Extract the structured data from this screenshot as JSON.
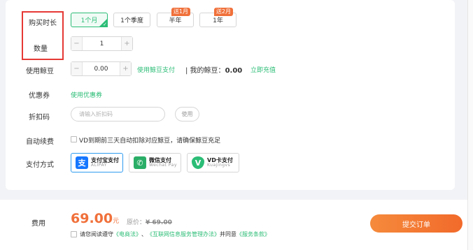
{
  "form": {
    "duration_label": "购买时长",
    "quantity_label": "数量",
    "bean_label": "使用鲸豆",
    "coupon_label": "优惠券",
    "discount_label": "折扣码",
    "autorenew_label": "自动续费",
    "payment_label": "支付方式"
  },
  "durations": [
    {
      "label": "1个月",
      "selected": true,
      "tag": ""
    },
    {
      "label": "1个季度",
      "selected": false,
      "tag": ""
    },
    {
      "label": "半年",
      "selected": false,
      "tag": "送1月"
    },
    {
      "label": "1年",
      "selected": false,
      "tag": "送2月"
    }
  ],
  "quantity": {
    "minus": "−",
    "value": "1",
    "plus": "+"
  },
  "beans": {
    "minus": "−",
    "value": "0.00",
    "plus": "+",
    "pay_link": "使用鲸豆支付",
    "my_beans_prefix": "| 我的鲸豆：",
    "my_beans_value": "0.00",
    "recharge_link": "立即充值"
  },
  "coupon": {
    "link": "使用优惠券"
  },
  "discount": {
    "placeholder": "请输入折扣码",
    "use_button": "使用"
  },
  "autorenew": {
    "text": "VD到期前三天自动扣除对应鲸豆，请确保鲸豆充足",
    "checked": false
  },
  "payments": [
    {
      "name": "支付宝支付",
      "sub": "ALIPAY",
      "icon": "alipay-icon",
      "glyph": "支",
      "color": "#1677ff",
      "selected": true
    },
    {
      "name": "微信支付",
      "sub": "Wechat Pay",
      "icon": "wechat-icon",
      "glyph": "✆",
      "color": "#2aae67",
      "selected": false
    },
    {
      "name": "VD卡支付",
      "sub": "Kuajingvs",
      "icon": "vd-card-icon",
      "glyph": "V",
      "color": "#2bbd76",
      "selected": false
    }
  ],
  "footer": {
    "fee_label": "费用",
    "price": "69.00",
    "price_unit": "元",
    "orig_label": "原价：",
    "orig_price": "¥ 69.00",
    "agree_prefix": "请您阅读遵守",
    "law1": "《电商法》",
    "sep": "、",
    "law2": "《互联网信息服务管理办法》",
    "agree_mid": "并同意",
    "terms": "《服务条款》",
    "submit": "提交订单"
  },
  "colors": {
    "accent_green": "#2bbd76",
    "accent_orange": "#f0703a",
    "highlight_red": "#e53935",
    "alipay_blue": "#2e9cf0"
  }
}
